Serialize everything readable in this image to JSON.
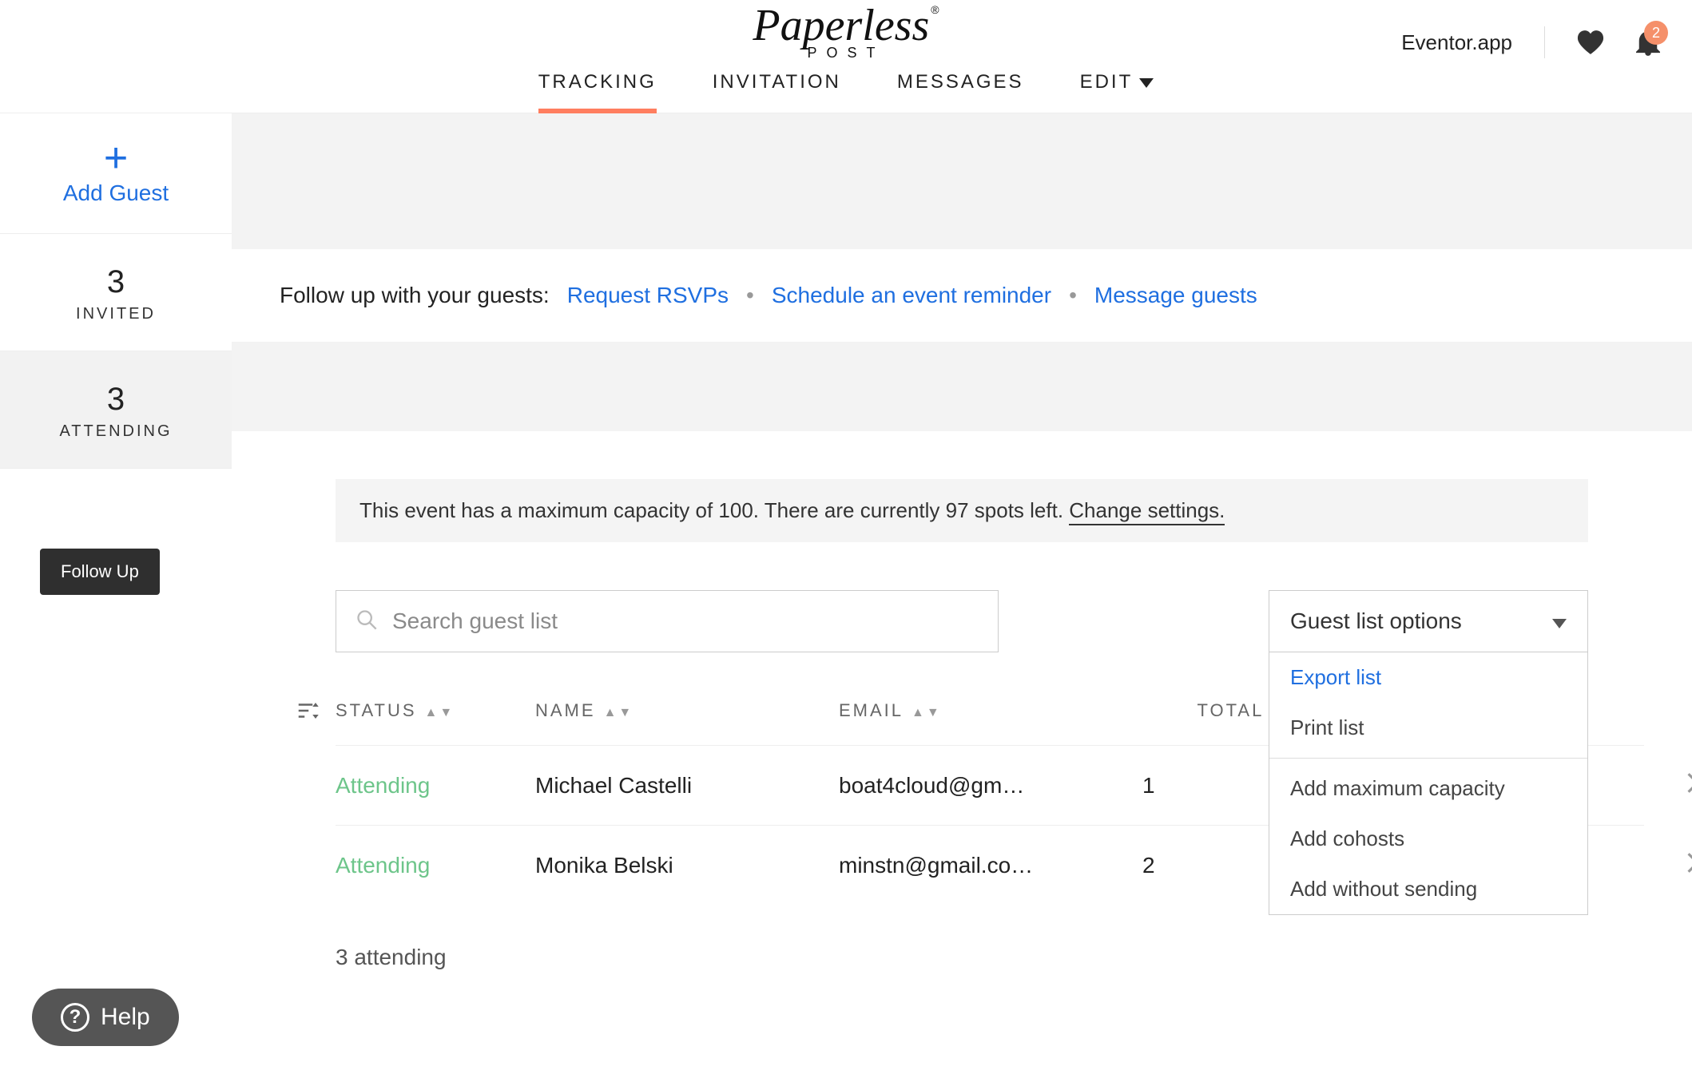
{
  "brand": {
    "script": "Paperless",
    "sub": "POST",
    "reg": "®"
  },
  "header": {
    "app_name": "Eventor.app",
    "notifications_count": "2"
  },
  "nav": {
    "tracking": "TRACKING",
    "invitation": "INVITATION",
    "messages": "MESSAGES",
    "edit": "EDIT"
  },
  "sidebar": {
    "add_guest": "Add Guest",
    "invited_count": "3",
    "invited_label": "INVITED",
    "attending_count": "3",
    "attending_label": "ATTENDING",
    "follow_up_btn": "Follow Up"
  },
  "followup_bar": {
    "prompt": "Follow up with your guests:",
    "request_rsvp": "Request RSVPs",
    "schedule_reminder": "Schedule an event reminder",
    "message_guests": "Message guests"
  },
  "capacity": {
    "text": "This event has a maximum capacity of 100. There are currently 97 spots left. ",
    "change": "Change settings."
  },
  "search": {
    "placeholder": "Search guest list"
  },
  "options": {
    "button": "Guest list options",
    "export": "Export list",
    "print": "Print list",
    "add_capacity": "Add maximum capacity",
    "add_cohosts": "Add cohosts",
    "add_without_sending": "Add without sending"
  },
  "table": {
    "headers": {
      "status": "STATUS",
      "name": "NAME",
      "email": "EMAIL",
      "total": "TOTAL"
    },
    "rows": [
      {
        "status": "Attending",
        "name": "Michael Castelli",
        "email": "boat4cloud@gm…",
        "total": "1"
      },
      {
        "status": "Attending",
        "name": "Monika Belski",
        "email": "minstn@gmail.co…",
        "total": "2"
      }
    ],
    "summary": "3 attending"
  },
  "help": {
    "label": "Help"
  }
}
